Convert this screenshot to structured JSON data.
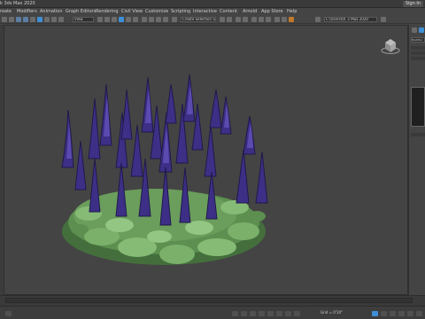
{
  "window": {
    "title": "k 3ds Max 2020",
    "sign_in": "Sign In"
  },
  "menu": [
    "reate",
    "Modifiers",
    "Animation",
    "Graph Editors",
    "Rendering",
    "Civil View",
    "Customize",
    "Scripting",
    "Interactive",
    "Content",
    "Arnold",
    "App Store",
    "Help"
  ],
  "toolbar": {
    "filter_value": "View",
    "selection_set_placeholder": "Create Selection Se",
    "workspace_value": "C:\\Users\\Ol..s Max 2020"
  },
  "command_panel": {
    "modifier_list": "Modifier"
  },
  "viewport": {
    "label": ""
  },
  "status": {
    "grid_value": "Grid = 0'10\""
  },
  "colors": {
    "viewport_bg": "#444444",
    "flower_purple": "#3d2f86",
    "flower_dark": "#1e1a4a",
    "leaf_green": "#7ab06a",
    "leaf_dark": "#446f3c",
    "accent_blue": "#3e8fd6"
  }
}
